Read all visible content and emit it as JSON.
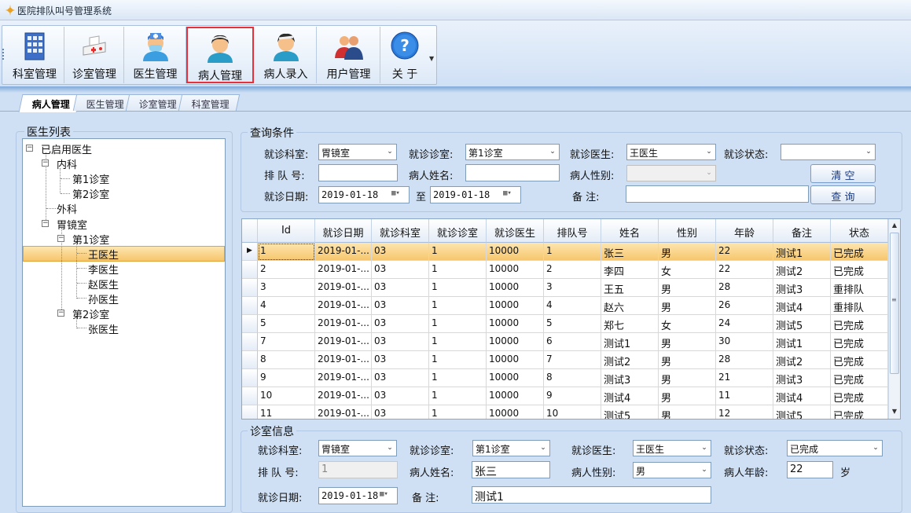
{
  "window": {
    "title": "医院排队叫号管理系统"
  },
  "toolbar": {
    "buttons": [
      {
        "label": "科室管理",
        "icon": "building-icon"
      },
      {
        "label": "诊室管理",
        "icon": "clinic-room-icon"
      },
      {
        "label": "医生管理",
        "icon": "doctor-icon"
      },
      {
        "label": "病人管理",
        "icon": "patient-icon"
      },
      {
        "label": "病人录入",
        "icon": "patient-entry-icon"
      },
      {
        "label": "用户管理",
        "icon": "users-icon"
      },
      {
        "label": "关  于",
        "icon": "help-icon"
      }
    ],
    "active_index": 3
  },
  "tabs": [
    "病人管理",
    "医生管理",
    "诊室管理",
    "科室管理"
  ],
  "tree": {
    "title": "医生列表",
    "root": "已启用医生",
    "n1": "内科",
    "n1a": "第1诊室",
    "n1b": "第2诊室",
    "n2": "外科",
    "n3": "胃镜室",
    "n3a": "第1诊室",
    "d1": "王医生",
    "d2": "李医生",
    "d3": "赵医生",
    "d4": "孙医生",
    "n3b": "第2诊室",
    "d5": "张医生"
  },
  "query": {
    "title": "查询条件",
    "dept_label": "就诊科室:",
    "dept_value": "胃镜室",
    "room_label": "就诊诊室:",
    "room_value": "第1诊室",
    "doctor_label": "就诊医生:",
    "doctor_value": "王医生",
    "status_label": "就诊状态:",
    "status_value": "",
    "queue_label": "排 队 号:",
    "queue_value": "",
    "name_label": "病人姓名:",
    "name_value": "",
    "gender_label": "病人性别:",
    "gender_value": "",
    "clear_label": "清  空",
    "date_label": "就诊日期:",
    "date_from": "2019-01-18",
    "date_to_label": "至",
    "date_to": "2019-01-18",
    "note_label": "备    注:",
    "note_value": "",
    "search_label": "查  询"
  },
  "grid": {
    "columns": [
      "Id",
      "就诊日期",
      "就诊科室",
      "就诊诊室",
      "就诊医生",
      "排队号",
      "姓名",
      "性别",
      "年龄",
      "备注",
      "状态"
    ],
    "rows": [
      [
        "1",
        "2019-01-...",
        "03",
        "1",
        "10000",
        "1",
        "张三",
        "男",
        "22",
        "测试1",
        "已完成"
      ],
      [
        "2",
        "2019-01-...",
        "03",
        "1",
        "10000",
        "2",
        "李四",
        "女",
        "22",
        "测试2",
        "已完成"
      ],
      [
        "3",
        "2019-01-...",
        "03",
        "1",
        "10000",
        "3",
        "王五",
        "男",
        "28",
        "测试3",
        "重排队"
      ],
      [
        "4",
        "2019-01-...",
        "03",
        "1",
        "10000",
        "4",
        "赵六",
        "男",
        "26",
        "测试4",
        "重排队"
      ],
      [
        "5",
        "2019-01-...",
        "03",
        "1",
        "10000",
        "5",
        "郑七",
        "女",
        "24",
        "测试5",
        "已完成"
      ],
      [
        "7",
        "2019-01-...",
        "03",
        "1",
        "10000",
        "6",
        "测试1",
        "男",
        "30",
        "测试1",
        "已完成"
      ],
      [
        "8",
        "2019-01-...",
        "03",
        "1",
        "10000",
        "7",
        "测试2",
        "男",
        "28",
        "测试2",
        "已完成"
      ],
      [
        "9",
        "2019-01-...",
        "03",
        "1",
        "10000",
        "8",
        "测试3",
        "男",
        "21",
        "测试3",
        "已完成"
      ],
      [
        "10",
        "2019-01-...",
        "03",
        "1",
        "10000",
        "9",
        "测试4",
        "男",
        "11",
        "测试4",
        "已完成"
      ],
      [
        "11",
        "2019-01-...",
        "03",
        "1",
        "10000",
        "10",
        "测试5",
        "男",
        "12",
        "测试5",
        "已完成"
      ]
    ],
    "selected_row": 0
  },
  "detail": {
    "title": "诊室信息",
    "dept_label": "就诊科室:",
    "dept_value": "胃镜室",
    "room_label": "就诊诊室:",
    "room_value": "第1诊室",
    "doctor_label": "就诊医生:",
    "doctor_value": "王医生",
    "status_label": "就诊状态:",
    "status_value": "已完成",
    "queue_label": "排 队 号:",
    "queue_value": "1",
    "name_label": "病人姓名:",
    "name_value": "张三",
    "gender_label": "病人性别:",
    "gender_value": "男",
    "age_label": "病人年龄:",
    "age_value": "22",
    "age_unit": "岁",
    "date_label": "就诊日期:",
    "date_value": "2019-01-18",
    "note_label": "备    注:",
    "note_value": "测试1"
  }
}
